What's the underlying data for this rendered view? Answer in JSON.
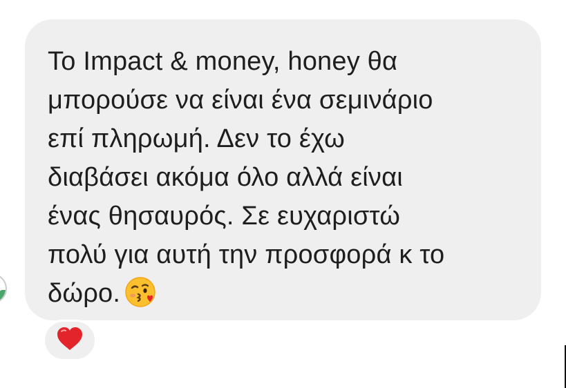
{
  "message": {
    "lines": [
      "Το Impact & money, honey θα",
      "μπορούσε να είναι ένα σεμινάριο",
      "επί πληρωμή. Δεν το έχω",
      "διαβάσει ακόμα όλο αλλά είναι",
      "ένας θησαυρός. Σε ευχαριστώ",
      "πολύ για αυτή την προσφορά κ το",
      "δώρο."
    ],
    "trailing_emoji": "face-blowing-a-kiss-icon",
    "bubble_color": "#efefef",
    "text_color": "#1e1e1e"
  },
  "reaction": {
    "emoji": "red-heart-icon",
    "color": "#e3242b"
  }
}
